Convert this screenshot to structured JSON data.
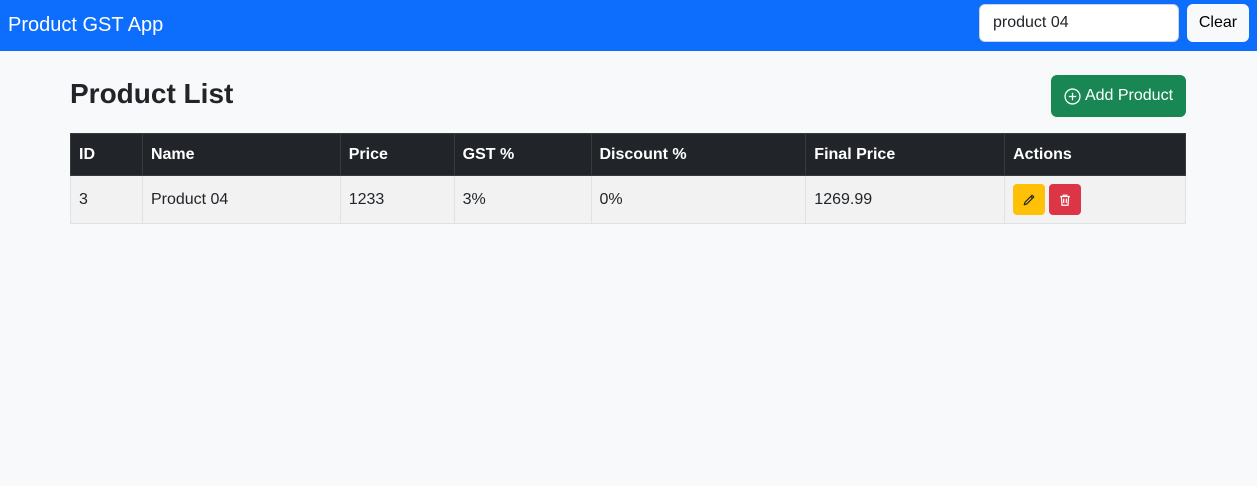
{
  "navbar": {
    "brand": "Product GST App",
    "search_value": "product 04",
    "clear_label": "Clear"
  },
  "page": {
    "title": "Product List",
    "add_label": "Add Product"
  },
  "table": {
    "headers": [
      "ID",
      "Name",
      "Price",
      "GST %",
      "Discount %",
      "Final Price",
      "Actions"
    ],
    "rows": [
      {
        "id": "3",
        "name": "Product 04",
        "price": "1233",
        "gst": "3%",
        "discount": "0%",
        "final": "1269.99"
      }
    ]
  },
  "icons": {
    "add": "plus-circle-icon",
    "edit": "pencil-icon",
    "delete": "trash-icon"
  },
  "colors": {
    "navbar": "#0d6efd",
    "add_button": "#198754",
    "edit_button": "#ffc107",
    "delete_button": "#dc3545",
    "table_header": "#212529"
  }
}
